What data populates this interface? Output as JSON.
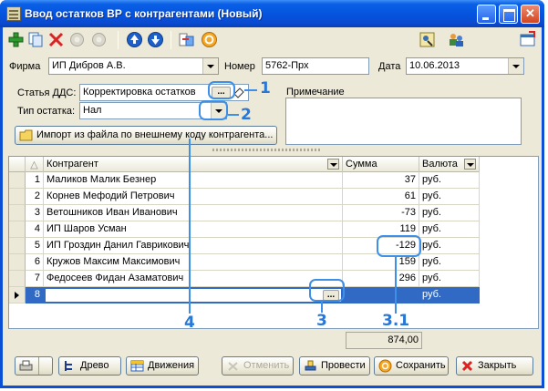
{
  "window": {
    "title": "Ввод остатков ВР с контрагентами (Новый)",
    "min_label": "",
    "max_label": "",
    "close_label": "✕"
  },
  "toolbar": {
    "icons": [
      "add-icon",
      "copy-icon",
      "delete-icon",
      "disabled-circle-icon",
      "disabled-circle-icon",
      "arrow-up-icon",
      "arrow-down-icon",
      "transfer-icon",
      "refresh-icon",
      "structure-icon",
      "users-icon",
      "new-window-icon"
    ]
  },
  "header": {
    "firma_label": "Фирма",
    "firma_value": "ИП Дибров А.В.",
    "nomer_label": "Номер",
    "nomer_value": "5762-Прх",
    "data_label": "Дата",
    "data_value": "10.06.2013",
    "statya_label": "Статья ДДС:",
    "statya_value": "Корректировка остатков",
    "tip_label": "Тип остатка:",
    "tip_value": "Нал",
    "import_label": "Импорт из файла по внешнему коду контрагента...",
    "note_label": "Примечание",
    "dots": "..."
  },
  "annotations": {
    "a1": "1",
    "a2": "2",
    "a3": "3",
    "a31": "3.1",
    "a4": "4"
  },
  "grid": {
    "columns": [
      "Контрагент",
      "Сумма",
      "Валюта"
    ],
    "rows": [
      {
        "n": "1",
        "name": "Маликов Малик Безнер",
        "sum": "37",
        "cur": "руб."
      },
      {
        "n": "2",
        "name": "Корнев Мефодий Петрович",
        "sum": "61",
        "cur": "руб."
      },
      {
        "n": "3",
        "name": "Ветошников Иван Иванович",
        "sum": "-73",
        "cur": "руб."
      },
      {
        "n": "4",
        "name": "ИП Шаров Усман",
        "sum": "119",
        "cur": "руб."
      },
      {
        "n": "5",
        "name": "ИП Гроздин Данил Гаврикович",
        "sum": "-129",
        "cur": "руб."
      },
      {
        "n": "6",
        "name": "Кружов Максим Максимович",
        "sum": "159",
        "cur": "руб."
      },
      {
        "n": "7",
        "name": "Федосеев Фидан Азаматович",
        "sum": "296",
        "cur": "руб."
      },
      {
        "n": "8",
        "name": "",
        "sum": "",
        "cur": "руб."
      }
    ],
    "total": "874,00"
  },
  "footer": {
    "tree": "Древо",
    "moves": "Движения",
    "cancel": "Отменить",
    "post": "Провести",
    "save": "Сохранить",
    "close": "Закрыть"
  }
}
